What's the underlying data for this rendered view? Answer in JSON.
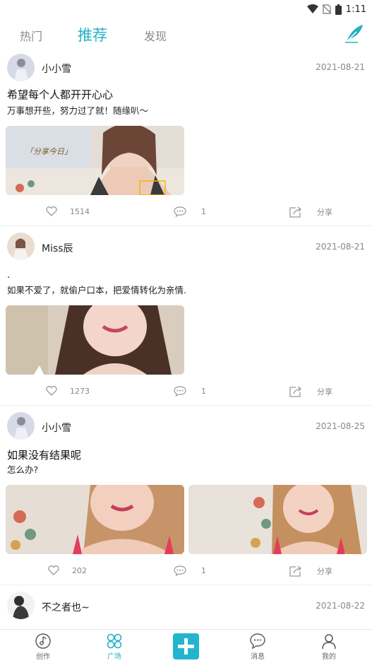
{
  "status": {
    "time": "1:11"
  },
  "tabs": [
    {
      "label": "热门"
    },
    {
      "label": "推荐"
    },
    {
      "label": "发现"
    }
  ],
  "colors": {
    "accent": "#23b0c5",
    "muted": "#888888"
  },
  "posts": [
    {
      "username": "小小雪",
      "date": "2021-08-21",
      "title": "希望每个人都开开心心",
      "text": "万事想开些，努力过了就！随缘叭～",
      "image_caption": "「分享今日」",
      "likes": "1514",
      "comments": "1",
      "share_label": "分享"
    },
    {
      "username": "Miss辰",
      "date": "2021-08-21",
      "title": ".",
      "text": "如果不爱了，就偷户口本，把爱情转化为亲情.",
      "likes": "1273",
      "comments": "1",
      "share_label": "分享"
    },
    {
      "username": "小小雪",
      "date": "2021-08-25",
      "title": "如果没有结果呢",
      "text": "怎么办?",
      "likes": "202",
      "comments": "1",
      "share_label": "分享"
    },
    {
      "username": "不之者也~",
      "date": "2021-08-22"
    }
  ],
  "nav": [
    {
      "label": "创作",
      "icon": "music-note-icon"
    },
    {
      "label": "广场",
      "icon": "clover-icon"
    },
    {
      "label": "",
      "icon": "plus-icon"
    },
    {
      "label": "消息",
      "icon": "message-icon"
    },
    {
      "label": "我的",
      "icon": "profile-icon"
    }
  ]
}
